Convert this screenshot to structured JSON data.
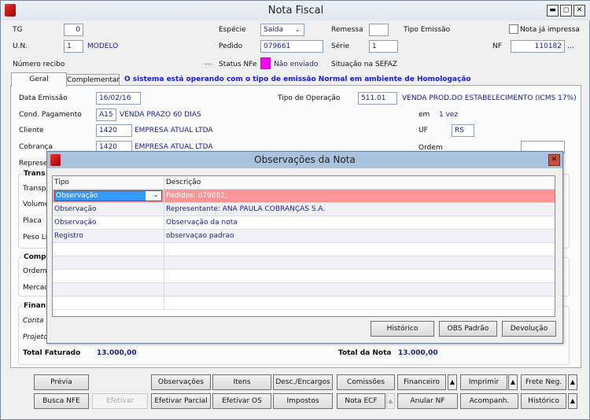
{
  "window": {
    "title": "Nota Fiscal",
    "min": "▬",
    "max": "◻",
    "close": "✕"
  },
  "header": {
    "tg_label": "TG",
    "tg_value": "0",
    "especie_label": "Espécie",
    "especie_value": "Saída",
    "remessa_label": "Remessa",
    "remessa_value": "",
    "tipo_emissao_label": "Tipo Emissão",
    "nota_impressa_label": "Nota já impressa",
    "nota_impressa_checked": false,
    "un_label": "U.N.",
    "un_value": "1",
    "un_name": "MODELO",
    "pedido_label": "Pedido",
    "pedido_value": "079661",
    "serie_label": "Série",
    "serie_value": "1",
    "nf_label": "NF",
    "nf_value": "110182",
    "ellipsis": "...",
    "recibo_label": "Número recibo",
    "status_label": "Status NFe",
    "status_value": "Não enviado",
    "status_color": "#ff00ff",
    "sefaz_label": "Situação na SEFAZ"
  },
  "tabs": [
    {
      "label": "Geral",
      "selected": true
    },
    {
      "label": "Complementar",
      "selected": false
    }
  ],
  "env_message": "O sistema está operando com o tipo de emissão Normal em ambiente de Homologação",
  "geral": {
    "data_emissao_label": "Data Emissão",
    "data_emissao": "16/02/16",
    "tipo_op_label": "Tipo de Operação",
    "tipo_op_code": "511.01",
    "tipo_op_desc": "VENDA PROD.DO ESTABELECIMENTO (ICMS 17%)",
    "cond_label": "Cond. Pagamento",
    "cond_code": "A15",
    "cond_desc": "VENDA PRAZO 60 DIAS",
    "em_label": "em",
    "em_value": "1 vez",
    "cliente_label": "Cliente",
    "cliente_code": "1420",
    "cliente_name": "EMPRESA ATUAL LTDA",
    "uf_label": "UF",
    "uf_value": "RS",
    "cobranca_label": "Cobrança",
    "cobranca_code": "1420",
    "cobranca_name": "EMPRESA ATUAL LTDA",
    "ordem_label": "Ordem",
    "repres_label": "Represe",
    "transp_group": "Trans",
    "transp_items": [
      "Transp",
      "Volume",
      "Placa",
      "Peso Lí"
    ],
    "comp_group": "Comp",
    "comp_items": [
      "Ordem",
      "Mercad"
    ],
    "fin_group": "Finan",
    "fin_items": [
      "Conta",
      "Projeto"
    ],
    "total_faturado_label": "Total Faturado",
    "total_faturado": "13.000,00",
    "total_nota_label": "Total da Nota",
    "total_nota": "13.000,00"
  },
  "modal": {
    "title": "Observações da Nota",
    "close": "✕",
    "columns": [
      "Tipo",
      "Descrição"
    ],
    "rows": [
      {
        "tipo": "Observação",
        "descricao": "Pedidos: 079661;"
      },
      {
        "tipo": "Observação",
        "descricao": "Representante: ANA PAULA COBRANÇAS S.A."
      },
      {
        "tipo": "Observação",
        "descricao": "Observação da nota"
      },
      {
        "tipo": "Registro",
        "descricao": "observaçao padrao"
      }
    ],
    "selected_row_color": "#ff9494",
    "buttons": [
      "Histórico",
      "OBS Padrão",
      "Devolução"
    ]
  },
  "buttons_row1": [
    "Prévia",
    "Observações",
    "Itens",
    "Desc./Encargos",
    "Comissões",
    "Financeiro",
    "Imprimir",
    "Frete Neg."
  ],
  "buttons_row2": [
    "Busca NFE",
    "Efetivar",
    "Efetivar Parcial",
    "Efetivar OS",
    "Impostos",
    "Nota ECF",
    "Anular NF",
    "Acompanh.",
    "Histórico"
  ],
  "arrow": "▲"
}
